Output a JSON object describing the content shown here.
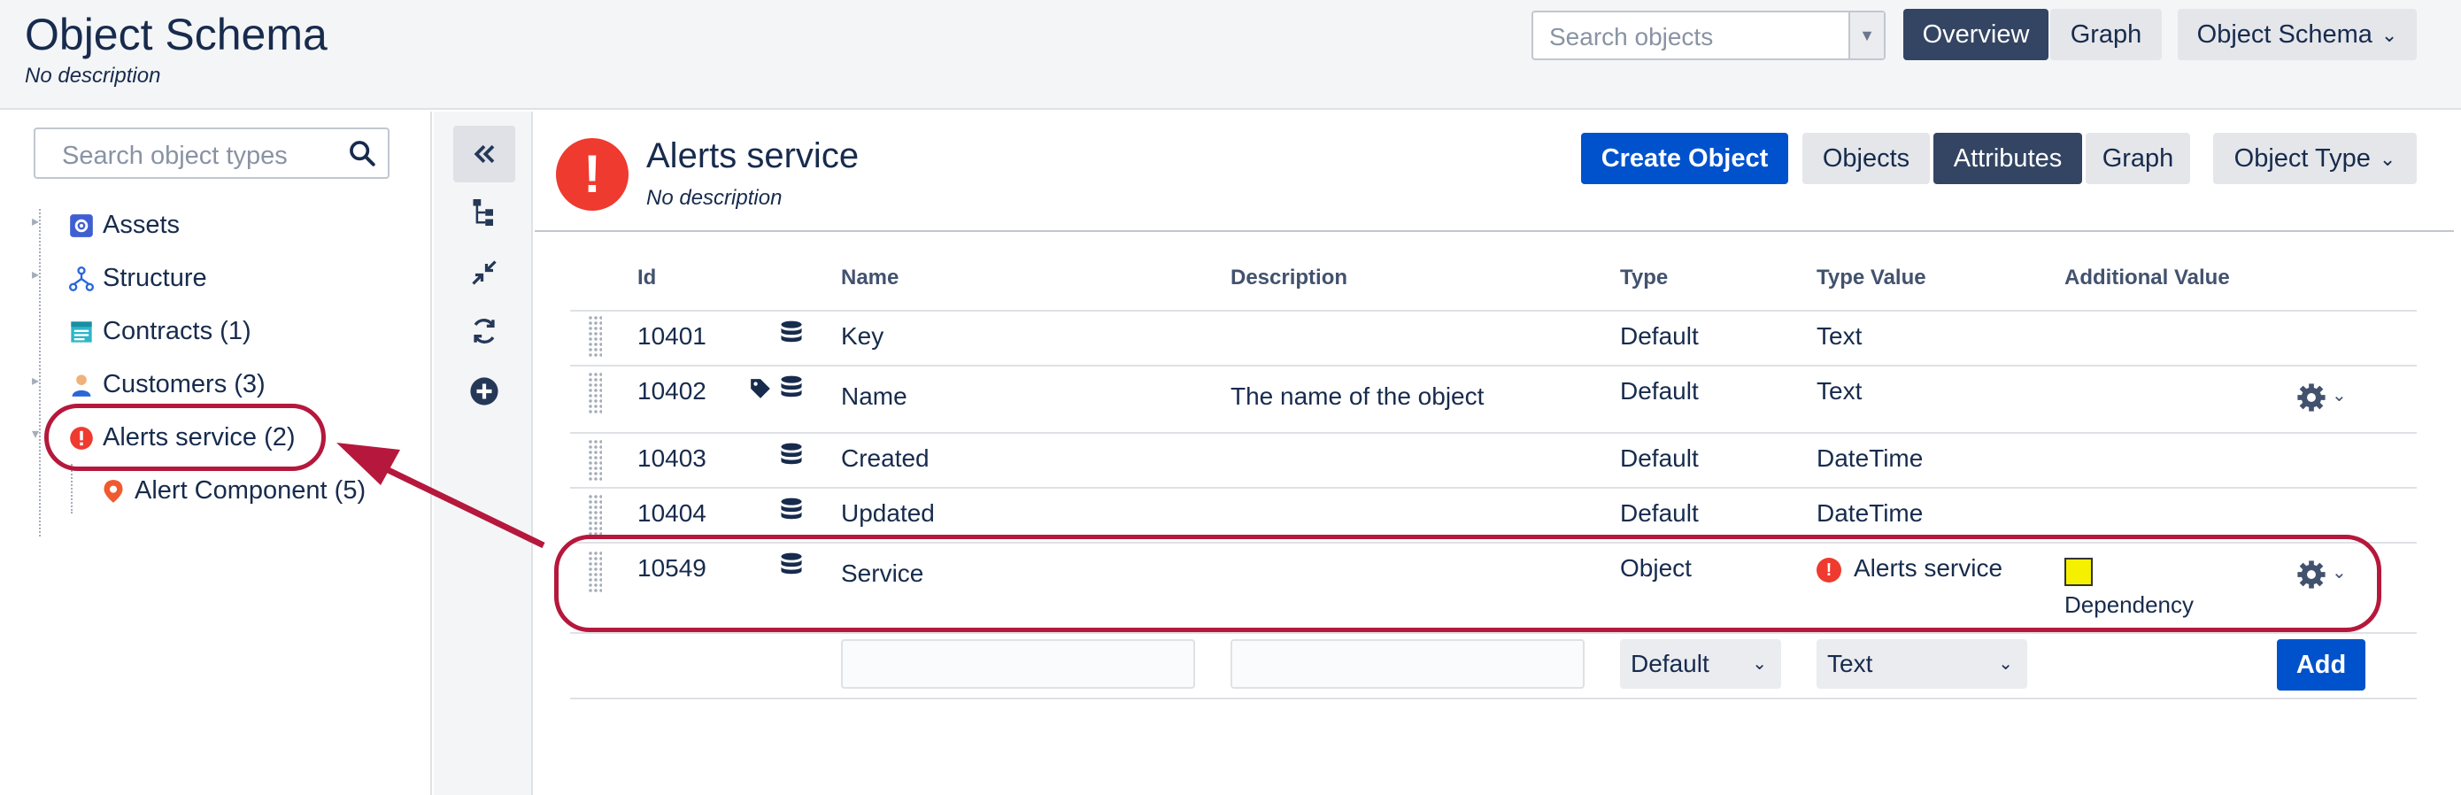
{
  "header": {
    "title": "Object Schema",
    "description": "No description",
    "search_placeholder": "Search objects",
    "tabs": [
      {
        "label": "Overview",
        "active": true
      },
      {
        "label": "Graph",
        "active": false
      }
    ],
    "menu_label": "Object Schema"
  },
  "sidebar": {
    "search_placeholder": "Search object types",
    "items": [
      {
        "label": "Assets",
        "icon": "gear-box-icon"
      },
      {
        "label": "Structure",
        "icon": "hierarchy-icon"
      },
      {
        "label": "Contracts (1)",
        "icon": "contract-icon"
      },
      {
        "label": "Customers (3)",
        "icon": "person-icon"
      },
      {
        "label": "Alerts service (2)",
        "icon": "alert-icon",
        "selected": true
      },
      {
        "label": "Alert Component (5)",
        "icon": "map-pin-icon",
        "child": true
      }
    ]
  },
  "object_type": {
    "title": "Alerts service",
    "description": "No description",
    "create_label": "Create Object",
    "tabs": [
      {
        "label": "Objects",
        "active": false
      },
      {
        "label": "Attributes",
        "active": true
      },
      {
        "label": "Graph",
        "active": false
      }
    ],
    "menu_label": "Object Type"
  },
  "table": {
    "columns": [
      "Id",
      "Name",
      "Description",
      "Type",
      "Type Value",
      "Additional Value"
    ],
    "rows": [
      {
        "id": "10401",
        "name": "Key",
        "description": "",
        "type": "Default",
        "type_value": "Text",
        "additional": ""
      },
      {
        "id": "10402",
        "name": "Name",
        "description": "The name of the object",
        "type": "Default",
        "type_value": "Text",
        "additional": ""
      },
      {
        "id": "10403",
        "name": "Created",
        "description": "",
        "type": "Default",
        "type_value": "DateTime",
        "additional": ""
      },
      {
        "id": "10404",
        "name": "Updated",
        "description": "",
        "type": "Default",
        "type_value": "DateTime",
        "additional": ""
      },
      {
        "id": "10549",
        "name": "Service",
        "description": "",
        "type": "Object",
        "type_value": "Alerts service",
        "additional": "Dependency"
      }
    ],
    "new_row": {
      "type_select": "Default",
      "type_value_select": "Text",
      "add_label": "Add"
    }
  },
  "colors": {
    "primary": "#0052cc",
    "dark_tab": "#344563",
    "alert_red": "#ef3a2f",
    "annotation": "#b5183c",
    "dependency_swatch": "#f5f000"
  }
}
